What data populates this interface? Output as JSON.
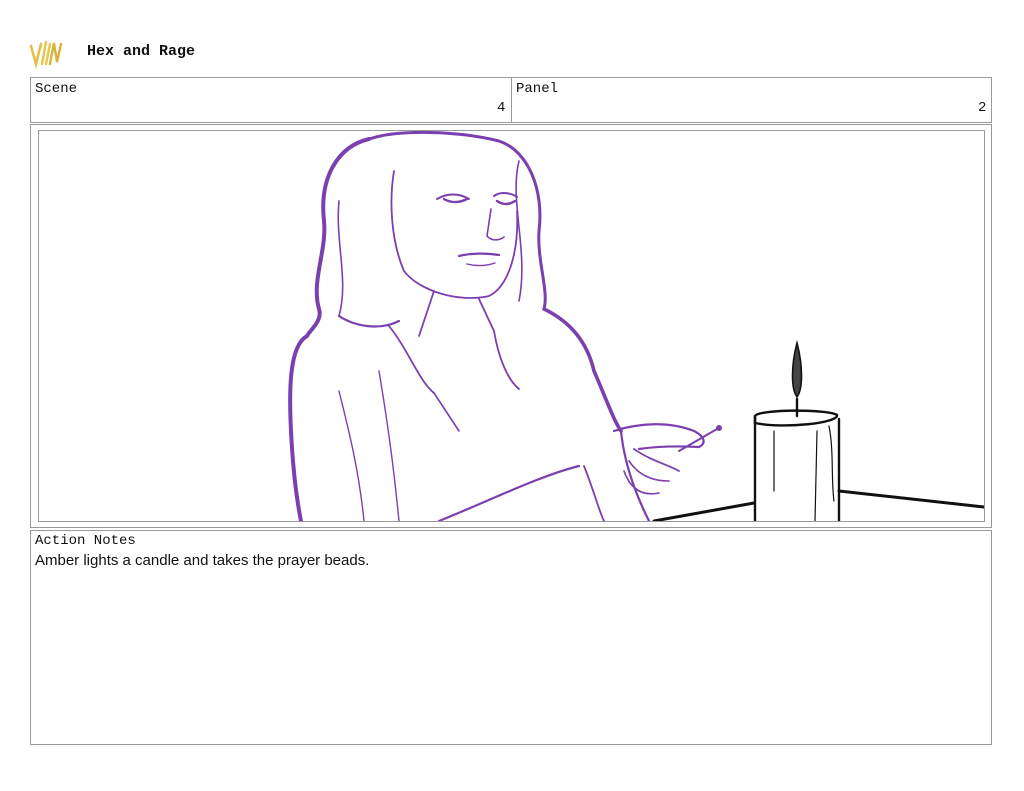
{
  "header": {
    "logo_icon": "handwritten-logo-icon",
    "title": "Hex and Rage"
  },
  "scene": {
    "label": "Scene",
    "value": "4"
  },
  "panel": {
    "label": "Panel",
    "value": "2"
  },
  "action_notes": {
    "label": "Action Notes",
    "text": "Amber lights a candle and takes the prayer beads."
  },
  "colors": {
    "sketch": "#7b3fb0",
    "ink": "#111111",
    "logo": "#e8c648",
    "border": "#9a9a9a"
  }
}
